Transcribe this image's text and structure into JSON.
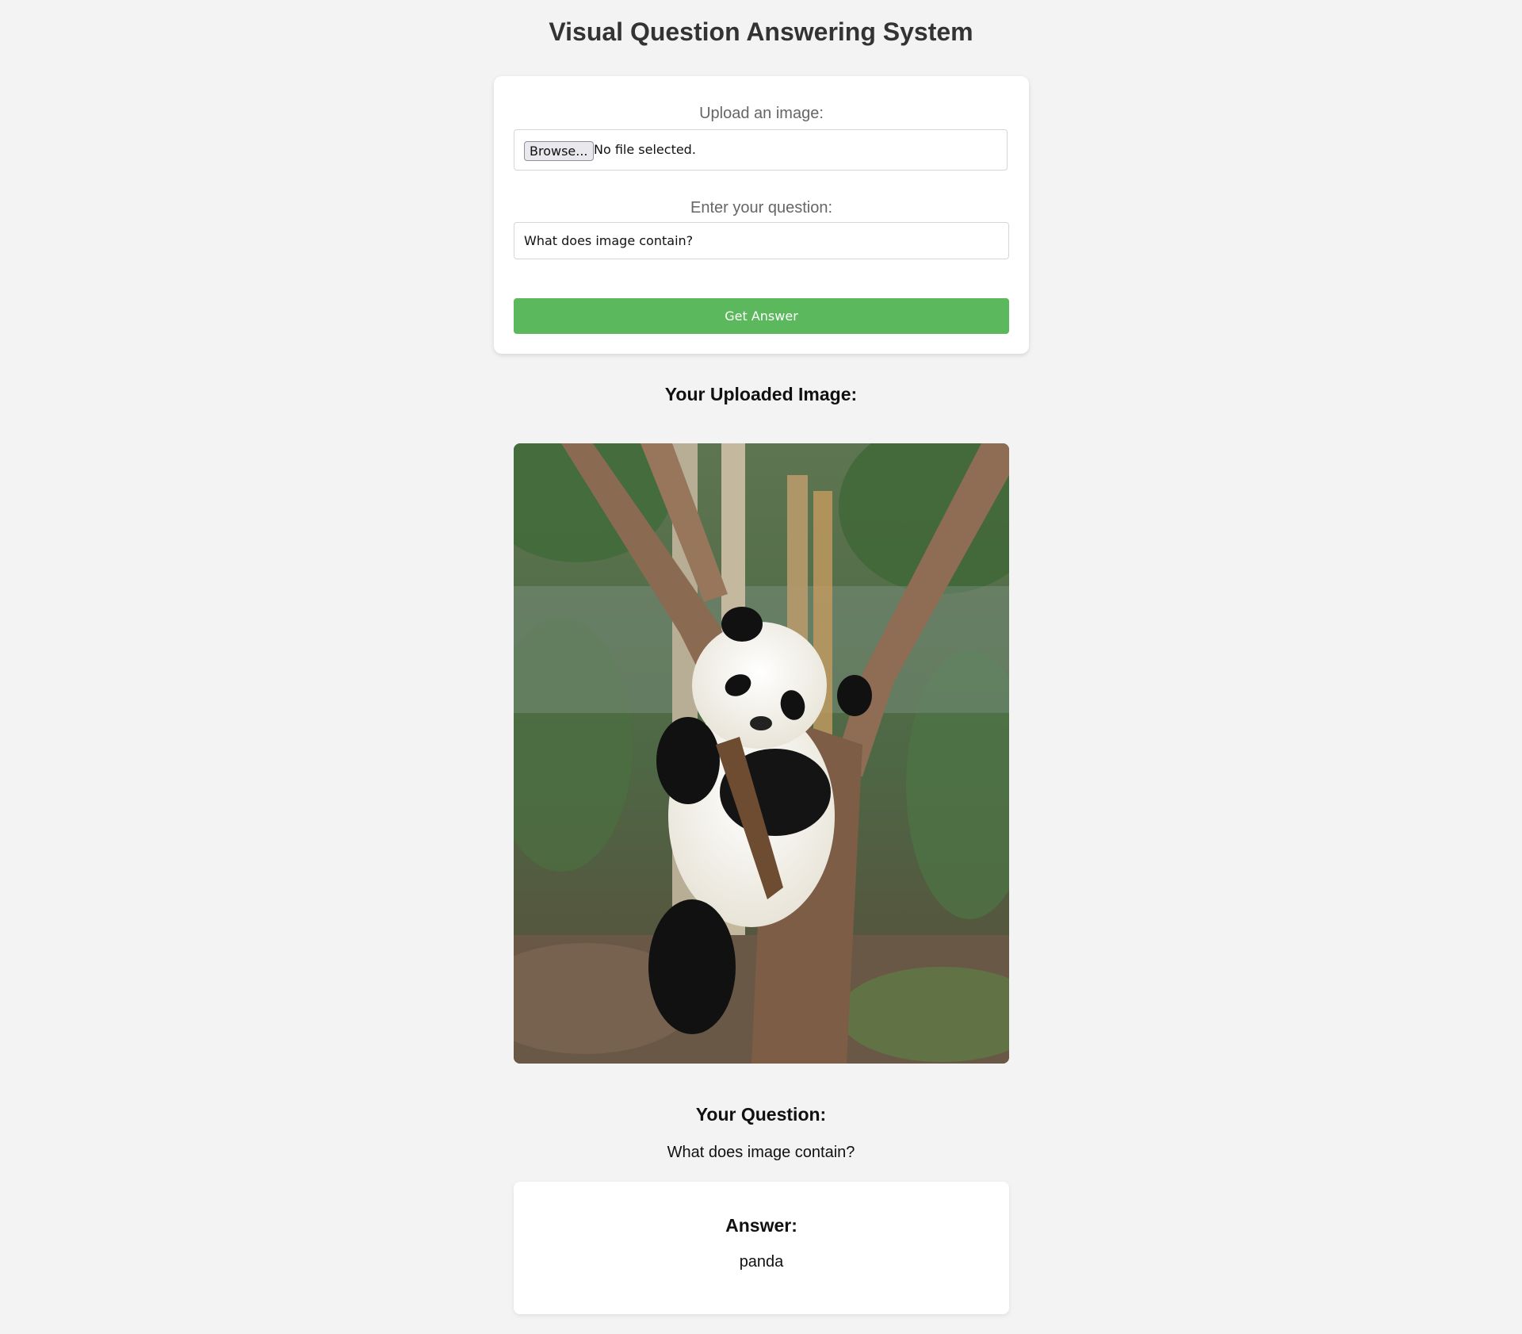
{
  "page": {
    "title": "Visual Question Answering System"
  },
  "form": {
    "upload_label": "Upload an image:",
    "browse_label": "Browse...",
    "file_status": "No file selected.",
    "question_label": "Enter your question:",
    "question_value": "What does image contain?",
    "submit_label": "Get Answer",
    "submit_color": "#5cb85c"
  },
  "results": {
    "uploaded_heading": "Your Uploaded Image:",
    "question_heading": "Your Question:",
    "question_text": "What does image contain?",
    "answer_heading": "Answer:",
    "answer_text": "panda"
  }
}
